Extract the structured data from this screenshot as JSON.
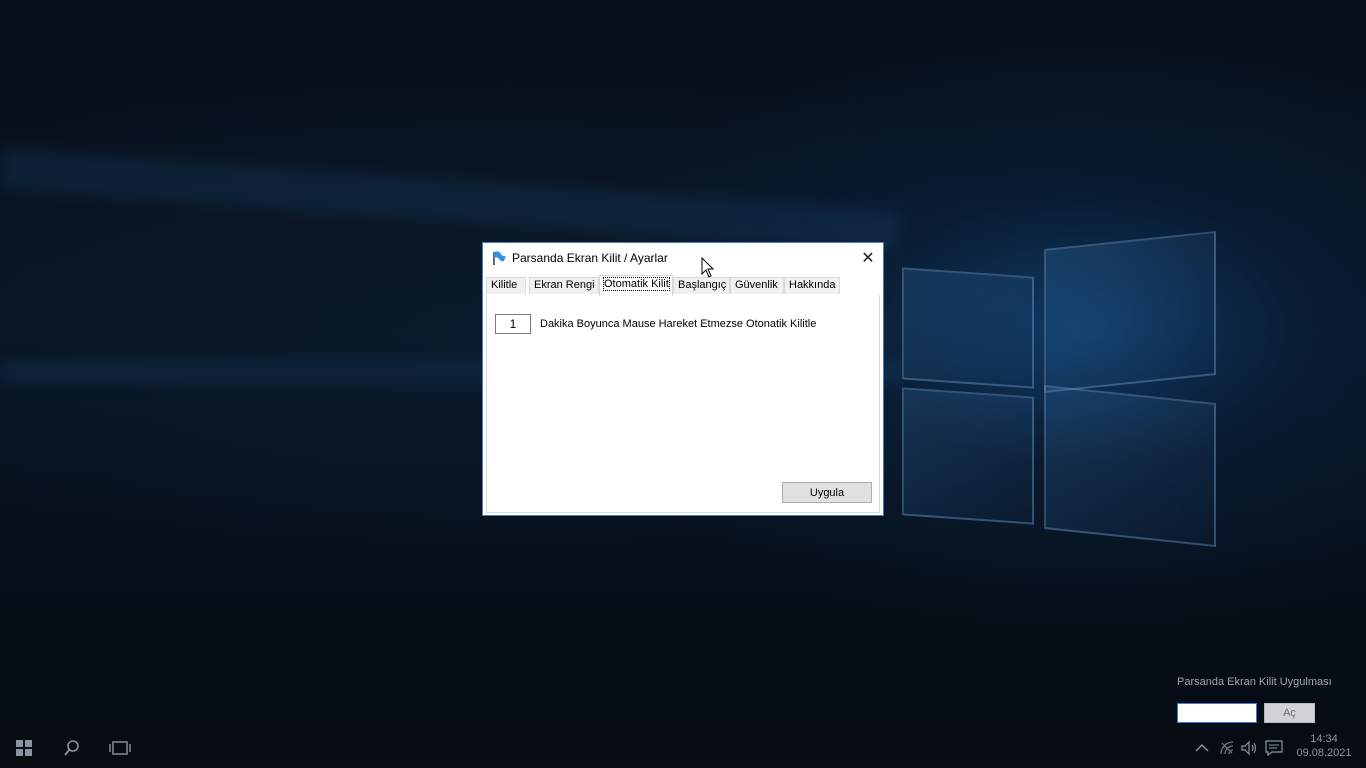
{
  "dialog": {
    "title": "Parsanda Ekran Kilit / Ayarlar",
    "close_glyph": "✕",
    "tabs": [
      {
        "label": "Kilitle"
      },
      {
        "label": "Ekran Rengi"
      },
      {
        "label": "Otomatik Kilit"
      },
      {
        "label": "Başlangıç"
      },
      {
        "label": "Güvenlik"
      },
      {
        "label": "Hakkında"
      }
    ],
    "active_tab": "Otomatik Kilit",
    "auto_lock": {
      "minutes_value": "1",
      "description": "Dakika Boyunca Mause Hareket Etmezse Otonatik Kilitle"
    },
    "apply_label": "Uygula"
  },
  "unlock_panel": {
    "title": "Parsanda Ekran Kilit Uygulması",
    "password_value": "",
    "open_label": "Aç"
  },
  "taskbar": {
    "time": "14:34",
    "date": "09.08.2021",
    "icons": [
      "windows-start-icon",
      "search-icon",
      "task-view-icon",
      "chevron-up-icon",
      "network-icon",
      "volume-icon",
      "notification-icon"
    ]
  },
  "colors": {
    "dialog_border": "#4a7ec2",
    "input_focus": "#3d7ad6"
  }
}
